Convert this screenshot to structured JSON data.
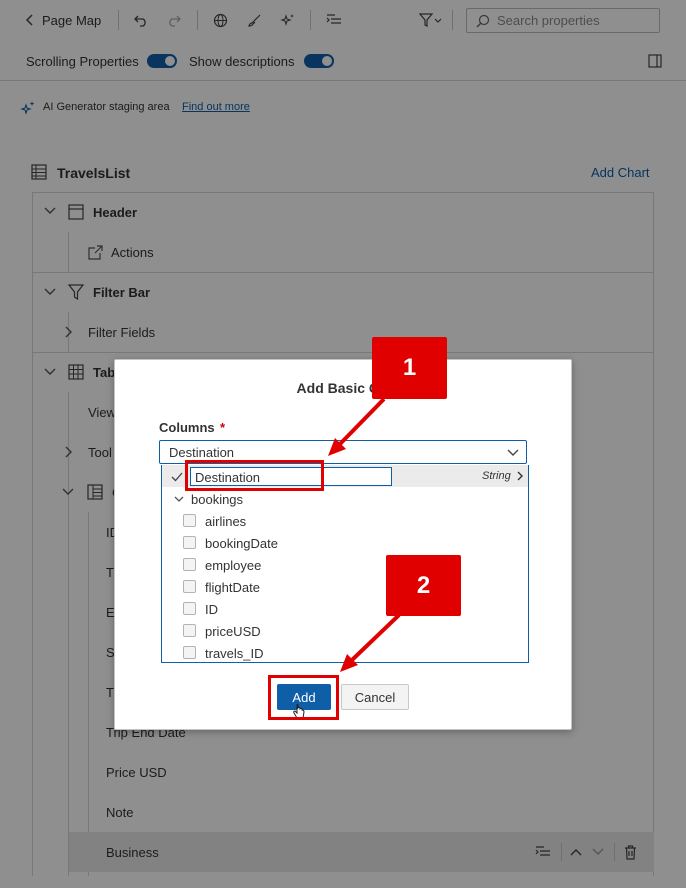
{
  "toolbar": {
    "back_label": "Page Map",
    "search_placeholder": "Search properties"
  },
  "options_bar": {
    "scrolling_label": "Scrolling Properties",
    "descriptions_label": "Show descriptions"
  },
  "ai_banner": {
    "text": "AI Generator staging area",
    "link": "Find out more"
  },
  "outline": {
    "title": "TravelsList",
    "add_chart": "Add Chart",
    "header": "Header",
    "actions": "Actions",
    "filter_bar": "Filter Bar",
    "filter_fields": "Filter Fields",
    "table": "Tab",
    "views": "View",
    "toolbar": "Tool",
    "columns_group": "C",
    "col_id": "ID",
    "col_t1": "T",
    "col_e": "E",
    "col_s": "S",
    "col_t2": "T",
    "trip_end_date": "Trip End Date",
    "price_usd": "Price USD",
    "note": "Note",
    "business": "Business"
  },
  "dialog": {
    "title": "Add Basic Col",
    "columns_label": "Columns",
    "required_mark": "*",
    "selected_value": "Destination",
    "list": {
      "first_item": "Destination",
      "first_item_type": "String",
      "group": "bookings",
      "items": [
        "airlines",
        "bookingDate",
        "employee",
        "flightDate",
        "ID",
        "priceUSD",
        "travels_ID"
      ]
    },
    "add_button": "Add",
    "cancel_button": "Cancel"
  },
  "annotations": {
    "callout_1": "1",
    "callout_2": "2"
  },
  "colors": {
    "accent": "#0f5ea8",
    "annotation_red": "#e00000"
  }
}
